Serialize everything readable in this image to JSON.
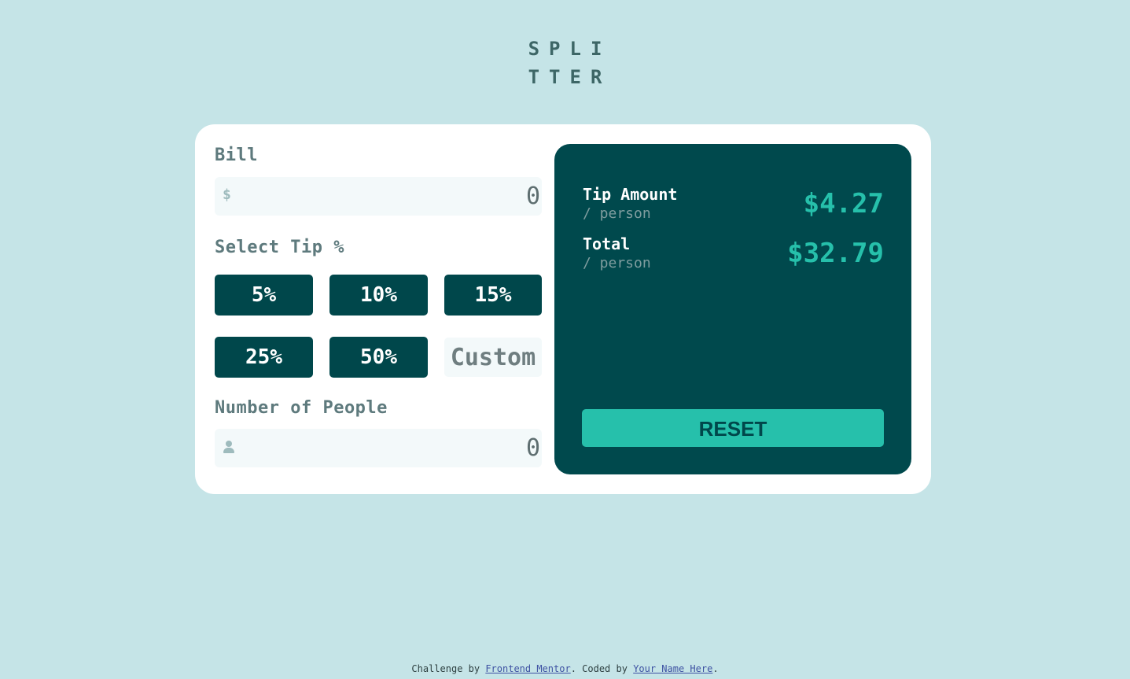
{
  "app": {
    "logo_line1": "SPLI",
    "logo_line2": "TTER"
  },
  "form": {
    "bill_label": "Bill",
    "bill_icon": "$",
    "bill_value": "0",
    "tip_label": "Select Tip %",
    "tip_options": [
      "5%",
      "10%",
      "15%",
      "25%",
      "50%"
    ],
    "custom_placeholder": "Custom",
    "people_label": "Number of People",
    "people_value": "0"
  },
  "results": {
    "tip_label": "Tip Amount",
    "tip_sub": "/ person",
    "tip_value": "$4.27",
    "total_label": "Total",
    "total_sub": "/ person",
    "total_value": "$32.79",
    "reset_label": "RESET"
  },
  "footer": {
    "prefix": "Challenge by ",
    "link1": "Frontend Mentor",
    "middle": ". Coded by ",
    "link2": "Your Name Here",
    "suffix": "."
  },
  "colors": {
    "background": "#c5e4e7",
    "dark_cyan": "#00474b",
    "accent": "#26c0ab",
    "card": "#ffffff"
  }
}
